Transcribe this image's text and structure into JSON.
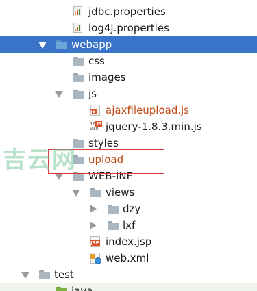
{
  "tree": {
    "items": [
      {
        "label": "jdbc.properties",
        "icon": "properties-file-icon"
      },
      {
        "label": "log4j.properties",
        "icon": "properties-file-icon"
      },
      {
        "label": "webapp",
        "icon": "web-folder-icon",
        "expanded": true,
        "selected": true
      },
      {
        "label": "css",
        "icon": "folder-icon"
      },
      {
        "label": "images",
        "icon": "folder-icon"
      },
      {
        "label": "js",
        "icon": "folder-icon",
        "expanded": true
      },
      {
        "label": "ajaxfileupload.js",
        "icon": "js-file-icon"
      },
      {
        "label": "jquery-1.8.3.min.js",
        "icon": "minified-js-file-icon"
      },
      {
        "label": "styles",
        "icon": "folder-icon"
      },
      {
        "label": "upload",
        "icon": "folder-icon"
      },
      {
        "label": "WEB-INF",
        "icon": "folder-icon",
        "expanded": true
      },
      {
        "label": "views",
        "icon": "folder-icon",
        "expanded": true
      },
      {
        "label": "dzy",
        "icon": "folder-icon",
        "expanded": false
      },
      {
        "label": "lxf",
        "icon": "folder-icon",
        "expanded": false
      },
      {
        "label": "index.jsp",
        "icon": "jsp-file-icon"
      },
      {
        "label": "web.xml",
        "icon": "xml-file-icon"
      },
      {
        "label": "test",
        "icon": "folder-icon",
        "expanded": true
      },
      {
        "label": "java",
        "icon": "source-folder-icon"
      }
    ]
  },
  "watermark": "吉云网",
  "colors": {
    "selection": "#3a74c8",
    "highlight_border": "#d33a3a",
    "orange_label": "#c04a15"
  }
}
